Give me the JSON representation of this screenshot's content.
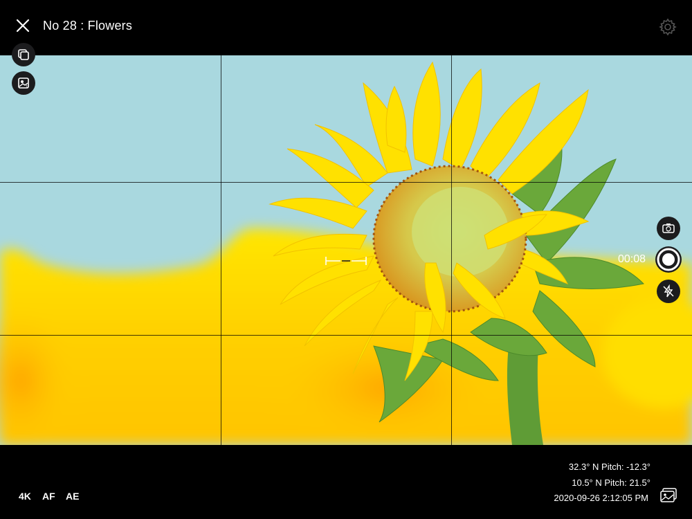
{
  "header": {
    "title": "No 28 : Flowers",
    "close_icon": "close-icon",
    "settings_icon": "gear-icon"
  },
  "left_tools": {
    "copy_icon": "copy-icon",
    "gallery_badge_icon": "photo-badge-icon"
  },
  "right_controls": {
    "flip_icon": "camera-flip-icon",
    "timer": "00:08",
    "record_icon": "record-icon",
    "flash_icon": "flash-off-icon"
  },
  "bottom": {
    "modes": [
      "4K",
      "AF",
      "AE"
    ],
    "sensor": {
      "line1": "32.3° N Pitch: -12.3°",
      "line2": "10.5° N Pitch: 21.5°",
      "timestamp": "2020-09-26 2:12:05 PM"
    },
    "gallery_icon": "gallery-icon"
  },
  "colors": {
    "sky": "#a7d7df",
    "petal": "#ffe100",
    "background_field": "#ffd400",
    "stem": "#5f9c36"
  }
}
